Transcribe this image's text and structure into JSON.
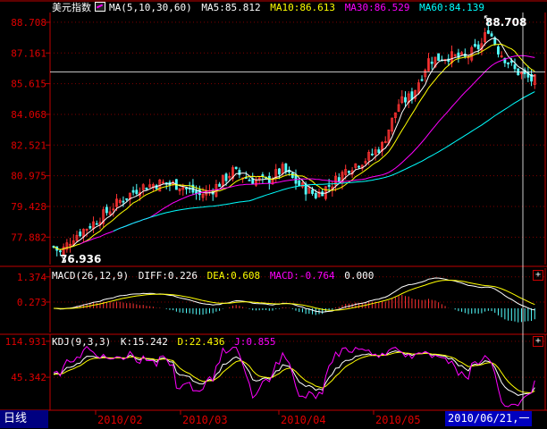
{
  "colors": {
    "bg": "#000000",
    "frame": "#c00000",
    "axis_text": "#e00000",
    "grid": "#800000",
    "up": "#ff3232",
    "down": "#54ffff",
    "ma5": "#ffffff",
    "ma10": "#ffff00",
    "ma30": "#ff00ff",
    "ma60": "#00ffff"
  },
  "legend": {
    "main": {
      "title": "美元指数",
      "ma_label": "MA(5,10,30,60)",
      "ma5": "MA5:85.812",
      "ma10": "MA10:86.613",
      "ma30": "MA30:86.529",
      "ma60": "MA60:84.139"
    },
    "macd": {
      "label": "MACD(26,12,9)",
      "diff": "DIFF:0.226",
      "dea": "DEA:0.608",
      "macd": "MACD:-0.764",
      "zero": "0.000"
    },
    "kdj": {
      "label": "KDJ(9,3,3)",
      "k": "K:15.242",
      "d": "D:22.436",
      "j": "J:0.855"
    }
  },
  "annotations": {
    "high": "88.708",
    "low": "76.936"
  },
  "footer": {
    "tab": "日线",
    "cursor_date": "2010/06/21,一"
  },
  "expand_icon": "+",
  "chart_data": [
    {
      "type": "candlestick",
      "title": "美元指数",
      "x_tick_labels": [
        "2010/02",
        "2010/03",
        "2010/04",
        "2010/05"
      ],
      "y_tick_labels": [
        "88.708",
        "87.161",
        "85.615",
        "84.068",
        "82.521",
        "80.975",
        "79.428",
        "77.882"
      ],
      "ylim": [
        76.5,
        89.2
      ],
      "high": 88.708,
      "low": 76.936,
      "close_anchors": [
        [
          0,
          77.4
        ],
        [
          2,
          77.1
        ],
        [
          6,
          77.9
        ],
        [
          12,
          78.6
        ],
        [
          20,
          79.7
        ],
        [
          26,
          80.4
        ],
        [
          32,
          80.6
        ],
        [
          38,
          80.5
        ],
        [
          44,
          80.0
        ],
        [
          48,
          80.3
        ],
        [
          54,
          81.2
        ],
        [
          59,
          80.8
        ],
        [
          64,
          80.7
        ],
        [
          69,
          81.3
        ],
        [
          74,
          80.5
        ],
        [
          79,
          80.0
        ],
        [
          84,
          80.6
        ],
        [
          89,
          81.4
        ],
        [
          94,
          81.8
        ],
        [
          99,
          82.5
        ],
        [
          104,
          84.6
        ],
        [
          108,
          85.0
        ],
        [
          113,
          86.8
        ],
        [
          119,
          87.0
        ],
        [
          124,
          86.9
        ],
        [
          129,
          87.6
        ],
        [
          131,
          88.4
        ],
        [
          134,
          87.3
        ],
        [
          139,
          86.3
        ],
        [
          144,
          85.8
        ]
      ],
      "ma_params": [
        5,
        10,
        30,
        60
      ],
      "ma_last": {
        "ma5": 85.812,
        "ma10": 86.613,
        "ma30": 86.529,
        "ma60": 84.139
      }
    },
    {
      "type": "macd",
      "params": [
        26,
        12,
        9
      ],
      "y_tick_labels": [
        "1.374",
        "0.273"
      ],
      "last": {
        "diff": 0.226,
        "dea": 0.608,
        "macd": -0.764
      }
    },
    {
      "type": "kdj",
      "params": [
        9,
        3,
        3
      ],
      "y_tick_labels": [
        "114.931",
        "45.342"
      ],
      "last": {
        "k": 15.242,
        "d": 22.436,
        "j": 0.855
      }
    }
  ]
}
